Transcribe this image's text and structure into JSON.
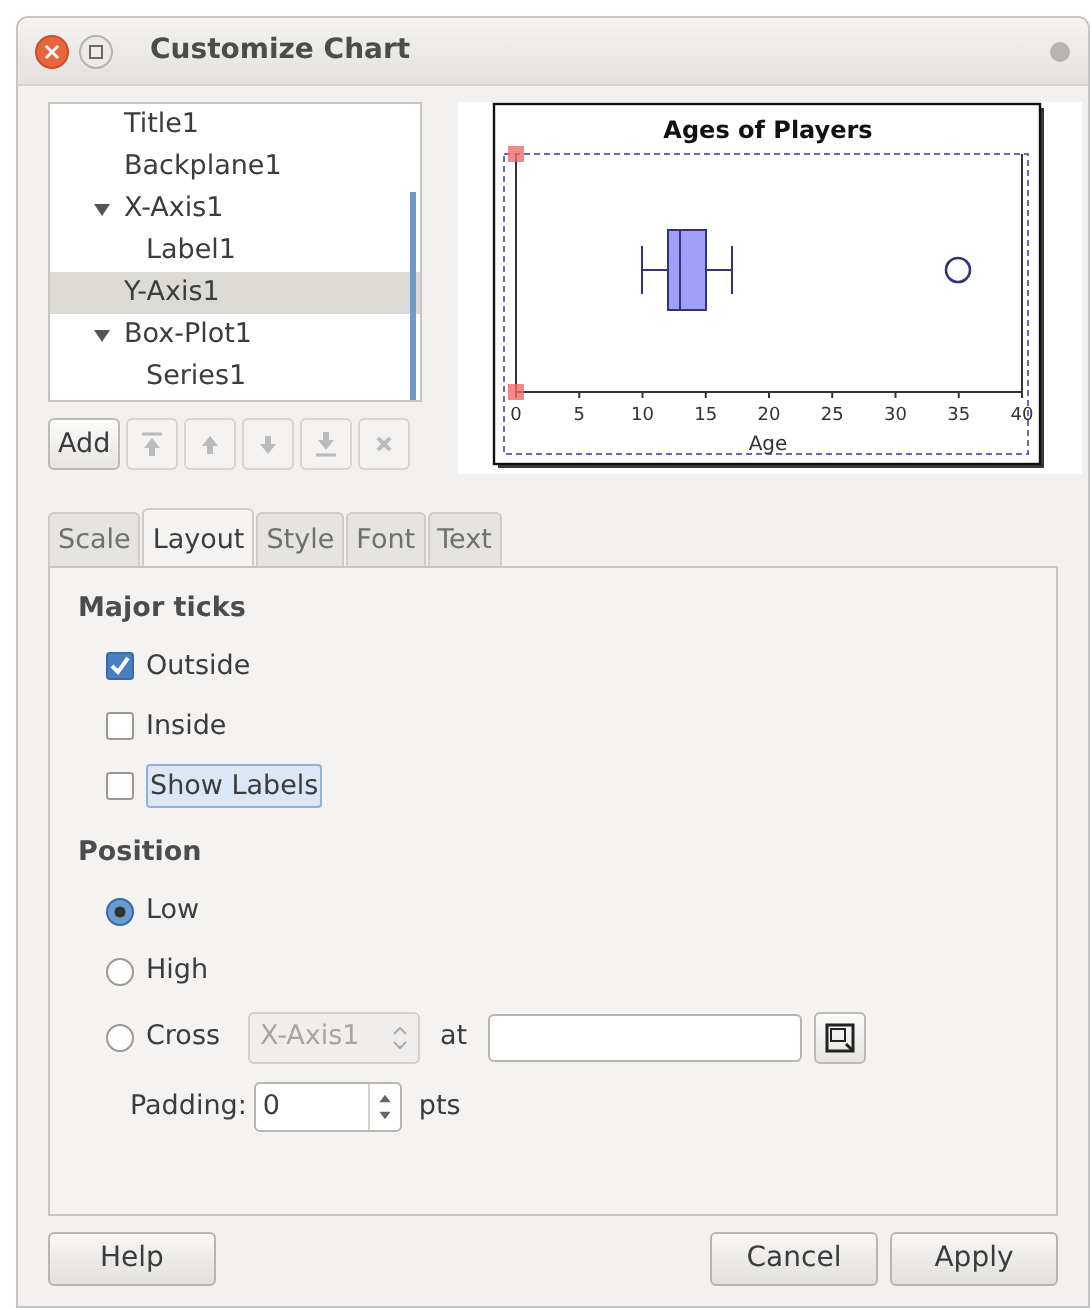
{
  "window": {
    "title": "Customize Chart"
  },
  "tree": [
    {
      "label": "Title1",
      "selected": false
    },
    {
      "label": "Backplane1",
      "selected": false
    },
    {
      "label": "X-Axis1",
      "selected": false,
      "expanded": true,
      "children": [
        {
          "label": "Label1",
          "selected": false
        }
      ]
    },
    {
      "label": "Y-Axis1",
      "selected": true
    },
    {
      "label": "Box-Plot1",
      "selected": false,
      "expanded": true,
      "children": [
        {
          "label": "Series1",
          "selected": false
        }
      ]
    }
  ],
  "tree_buttons": [
    {
      "kind": "text",
      "label": "Add",
      "disabled": false
    },
    {
      "kind": "move-top",
      "disabled": true
    },
    {
      "kind": "move-up",
      "disabled": true
    },
    {
      "kind": "move-down",
      "disabled": true
    },
    {
      "kind": "move-bottom",
      "disabled": true
    },
    {
      "kind": "remove",
      "disabled": true
    }
  ],
  "preview": {
    "title": "Ages of Players",
    "xlabel": "Age",
    "xticks": [
      "0",
      "5",
      "10",
      "15",
      "20",
      "25",
      "30",
      "35",
      "40"
    ]
  },
  "tabs": [
    {
      "label": "Scale",
      "selected": false
    },
    {
      "label": "Layout",
      "selected": true
    },
    {
      "label": "Style",
      "selected": false
    },
    {
      "label": "Font",
      "selected": false
    },
    {
      "label": "Text",
      "selected": false
    }
  ],
  "major_ticks": {
    "heading": "Major ticks",
    "options": [
      {
        "label": "Outside",
        "checked": true,
        "focused": false
      },
      {
        "label": "Inside",
        "checked": false,
        "focused": false
      },
      {
        "label": "Show Labels",
        "checked": false,
        "focused": true
      }
    ]
  },
  "position": {
    "heading": "Position",
    "options": [
      {
        "label": "Low",
        "selected": true
      },
      {
        "label": "High",
        "selected": false
      },
      {
        "label": "Cross",
        "selected": false
      }
    ],
    "cross_axis": {
      "value": "X-Axis1",
      "disabled": true
    },
    "at_label": "at",
    "padding": {
      "label": "Padding:",
      "value": "0",
      "unit": "pts"
    }
  },
  "buttons": [
    {
      "label": "Help"
    },
    {
      "label": "Cancel"
    },
    {
      "label": "Apply"
    }
  ]
}
